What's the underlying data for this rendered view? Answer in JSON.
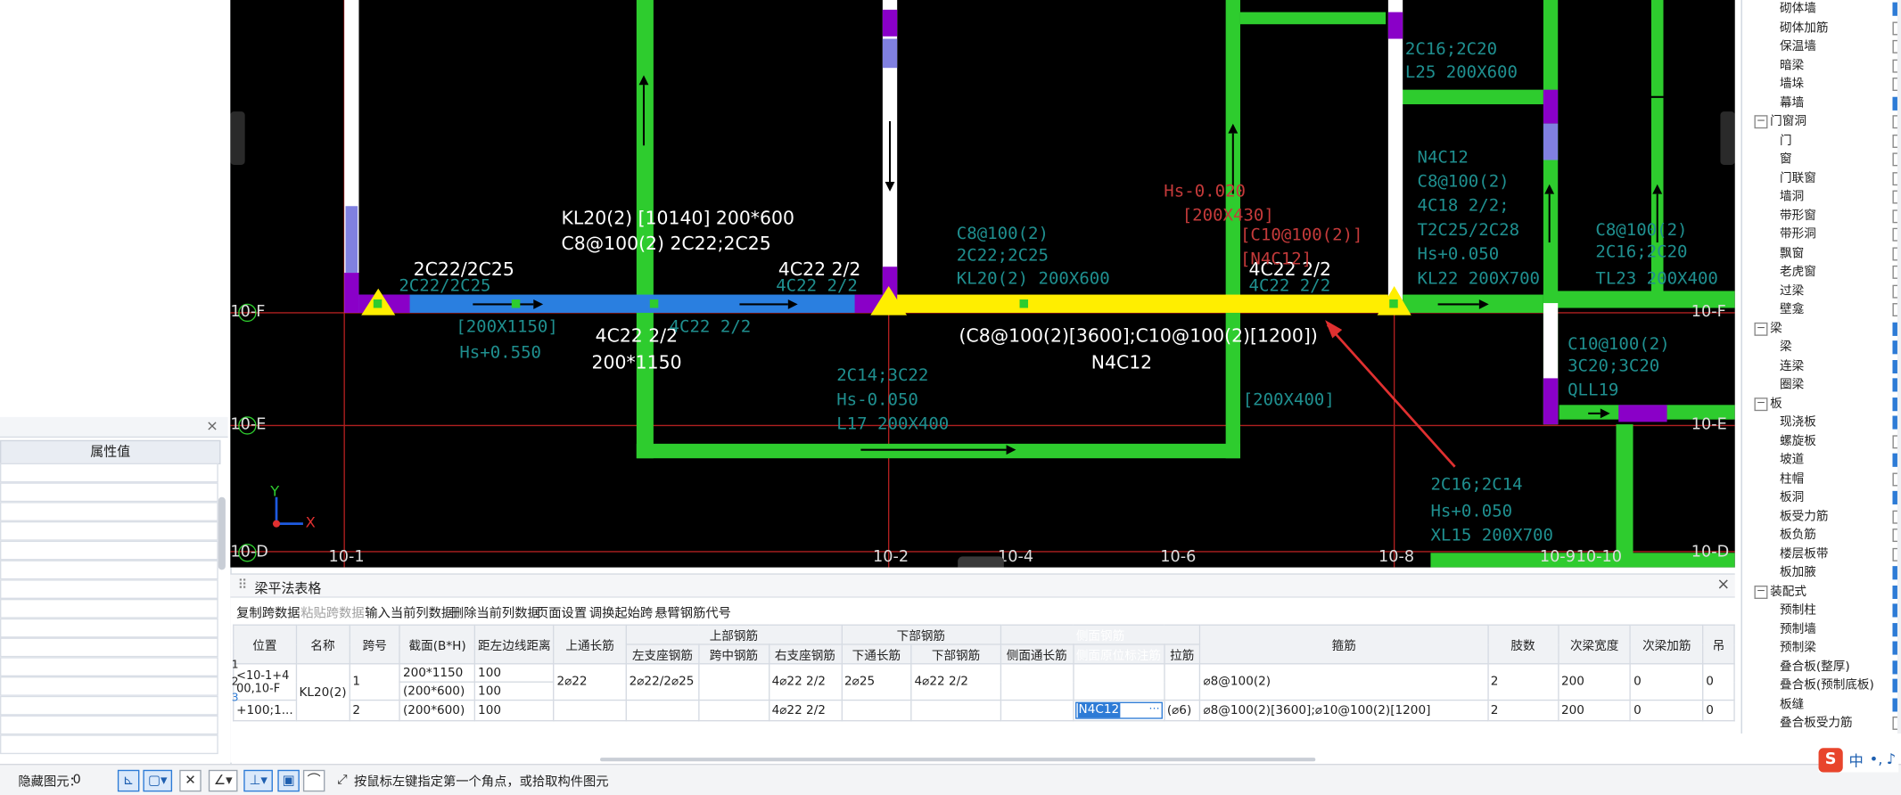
{
  "properties_panel": {
    "close": "×",
    "value_header": "属性值"
  },
  "cad": {
    "grid_rows": [
      "10-F",
      "10-E",
      "10-D"
    ],
    "grid_cols": [
      "10-1",
      "10-2",
      "10-4",
      "10-6",
      "10-8",
      "10-9",
      "10-10"
    ],
    "axis_x": "X",
    "axis_y": "Y",
    "label_kl20_1": "KL20(2) [10140] 200*600",
    "label_kl20_2": "C8@100(2) 2C22;2C25",
    "label_top_left": "2C22/2C25",
    "label_top_mid": "4C22 2/2",
    "label_top_right": "4C22 2/2",
    "label_bot_left1": "4C22 2/2",
    "label_bot_left2": "200*1150",
    "label_stirrup": "(C8@100(2)[3600];C10@100(2)[1200])",
    "label_n4c12": "N4C12",
    "teal_1": "[200X1150]",
    "teal_2": "Hs+0.550",
    "teal_3": "C8@100(2)",
    "teal_4": "2C22;2C25",
    "teal_5": "KL20(2) 200X600",
    "teal_6": "2C14;3C22",
    "teal_7": "Hs-0.050",
    "teal_8": "L17 200X400",
    "teal_9": "N4C12",
    "teal_10": "C8@100(2)",
    "teal_11": "4C18 2/2;",
    "teal_12": "T2C25/2C28",
    "teal_13": "Hs+0.050",
    "teal_14": "KL22 200X700",
    "teal_15": "2C16;2C20",
    "teal_16": "L25 200X600",
    "teal_17": "C8@100(2)",
    "teal_18": "2C16;2C20",
    "teal_19": "TL23 200X400",
    "teal_20": "C10@100(2)",
    "teal_21": "3C20;3C20",
    "teal_22": "QLL19",
    "teal_23": "2C16;2C14",
    "teal_24": "Hs+0.050",
    "teal_25": "XL15 200X700",
    "teal_26": "2C22/2C25",
    "teal_27": "4C22 2/2",
    "teal_28": "4C22 2/2",
    "teal_29": "4C22 2/2",
    "teal_30": "[200X400]",
    "red_1": "[C10@100(2)]",
    "red_2": "[N4C12]",
    "red_3": "Hs-0.020",
    "red_4": "[200X430]"
  },
  "tree": {
    "items": [
      {
        "label": "砌体墙",
        "group": false,
        "checked": true
      },
      {
        "label": "砌体加筋",
        "group": false,
        "checked": false
      },
      {
        "label": "保温墙",
        "group": false,
        "checked": false
      },
      {
        "label": "暗梁",
        "group": false,
        "checked": false
      },
      {
        "label": "墙垛",
        "group": false,
        "checked": false
      },
      {
        "label": "幕墙",
        "group": false,
        "checked": true
      },
      {
        "label": "门窗洞",
        "group": true,
        "checked": false
      },
      {
        "label": "门",
        "group": false,
        "checked": false
      },
      {
        "label": "窗",
        "group": false,
        "checked": false
      },
      {
        "label": "门联窗",
        "group": false,
        "checked": false
      },
      {
        "label": "墙洞",
        "group": false,
        "checked": false
      },
      {
        "label": "带形窗",
        "group": false,
        "checked": false
      },
      {
        "label": "带形洞",
        "group": false,
        "checked": false
      },
      {
        "label": "飘窗",
        "group": false,
        "checked": false
      },
      {
        "label": "老虎窗",
        "group": false,
        "checked": false
      },
      {
        "label": "过梁",
        "group": false,
        "checked": false
      },
      {
        "label": "壁龛",
        "group": false,
        "checked": false
      },
      {
        "label": "梁",
        "group": true,
        "checked": true
      },
      {
        "label": "梁",
        "group": false,
        "checked": true
      },
      {
        "label": "连梁",
        "group": false,
        "checked": true
      },
      {
        "label": "圈梁",
        "group": false,
        "checked": true
      },
      {
        "label": "板",
        "group": true,
        "checked": true
      },
      {
        "label": "现浇板",
        "group": false,
        "checked": true
      },
      {
        "label": "螺旋板",
        "group": false,
        "checked": false
      },
      {
        "label": "坡道",
        "group": false,
        "checked": true
      },
      {
        "label": "柱帽",
        "group": false,
        "checked": false
      },
      {
        "label": "板洞",
        "group": false,
        "checked": true
      },
      {
        "label": "板受力筋",
        "group": false,
        "checked": false
      },
      {
        "label": "板负筋",
        "group": false,
        "checked": false
      },
      {
        "label": "楼层板带",
        "group": false,
        "checked": false
      },
      {
        "label": "板加腋",
        "group": false,
        "checked": true
      },
      {
        "label": "装配式",
        "group": true,
        "checked": true
      },
      {
        "label": "预制柱",
        "group": false,
        "checked": true
      },
      {
        "label": "预制墙",
        "group": false,
        "checked": true
      },
      {
        "label": "预制梁",
        "group": false,
        "checked": true
      },
      {
        "label": "叠合板(整厚)",
        "group": false,
        "checked": true
      },
      {
        "label": "叠合板(预制底板)",
        "group": false,
        "checked": true
      },
      {
        "label": "板缝",
        "group": false,
        "checked": true
      },
      {
        "label": "叠合板受力筋",
        "group": false,
        "checked": false
      }
    ]
  },
  "table_panel": {
    "title": "梁平法表格",
    "close": "×",
    "toolbar": [
      "复制跨数据",
      "粘贴跨数据",
      "输入当前列数据",
      "删除当前列数据",
      "页面设置",
      "调换起始跨",
      "悬臂钢筋代号"
    ],
    "groups": {
      "top": "上部钢筋",
      "bottom": "下部钢筋",
      "side": "侧面钢筋"
    },
    "headers": [
      "位置",
      "名称",
      "跨号",
      "截面(B*H)",
      "距左边线距离",
      "上通长筋",
      "左支座钢筋",
      "跨中钢筋",
      "右支座钢筋",
      "下通长筋",
      "下部钢筋",
      "侧面通长筋",
      "侧面原位标注筋",
      "拉筋",
      "箍筋",
      "肢数",
      "次梁宽度",
      "次梁加筋",
      "吊"
    ],
    "row1": {
      "idx1": "1",
      "idx2": "2",
      "pos1": "<10-1+4",
      "pos2": "00,10-F",
      "name": "KL20(2)",
      "span": "1",
      "sec1": "200*1150",
      "dist1": "100",
      "sec2": "(200*600)",
      "dist2": "100",
      "top_cont": "2⌀22",
      "left_sup": "2⌀22/2⌀25",
      "mid": "",
      "right_sup": "4⌀22 2/2",
      "bot_cont": "2⌀25",
      "bot": "4⌀22 2/2",
      "side_cont": "",
      "side_orig": "",
      "tie": "",
      "stirrup": "⌀8@100(2)",
      "legs": "2",
      "sec_w": "200",
      "sec_add": "0",
      "hang": "0"
    },
    "row2": {
      "idx": "3",
      "pos": "+100;1...",
      "span": "2",
      "sec": "(200*600)",
      "dist": "100",
      "top_cont": "",
      "left_sup": "",
      "mid": "",
      "right_sup": "4⌀22 2/2",
      "bot_cont": "",
      "bot": "",
      "side_cont": "",
      "side_orig": "N4C12",
      "tie": "(⌀6)",
      "stirrup": "⌀8@100(2)[3600];⌀10@100(2)[1200]",
      "legs": "2",
      "sec_w": "200",
      "sec_add": "0",
      "hang": "0"
    }
  },
  "status": {
    "hidden_label": "隐藏图元：",
    "hidden_count": "0",
    "hint": "按鼠标左键指定第一个角点，或拾取构件图元"
  },
  "ime": {
    "label": "中"
  }
}
